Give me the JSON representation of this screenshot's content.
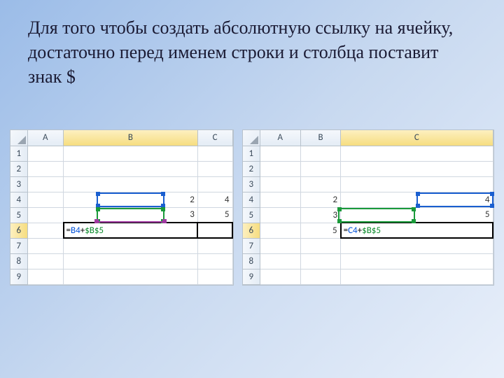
{
  "text": {
    "paragraph": "Для того чтобы создать абсолютную ссылку на ячейку, достаточно перед именем строки и столбца поставит знак $"
  },
  "sheet_left": {
    "columns": [
      "A",
      "B",
      "C"
    ],
    "rows": [
      "1",
      "2",
      "3",
      "4",
      "5",
      "6",
      "7",
      "8",
      "9"
    ],
    "active_column": "B",
    "active_row": "6",
    "cells": {
      "B4": "2",
      "C4": "4",
      "B5": "3",
      "C5": "5"
    },
    "formula_cell": "B6",
    "formula_parts": {
      "eq": "=",
      "ref1": "B4",
      "plus": "+",
      "ref2": "$B$5"
    },
    "ranges": {
      "blue": "B4",
      "green": "B5",
      "purple_underline": "B5"
    }
  },
  "sheet_right": {
    "columns": [
      "A",
      "B",
      "C"
    ],
    "rows": [
      "1",
      "2",
      "3",
      "4",
      "5",
      "6",
      "7",
      "8",
      "9"
    ],
    "active_column": "C",
    "active_row": "6",
    "cells": {
      "B4": "2",
      "C4": "4",
      "B5": "3",
      "C5": "5",
      "B6": "5"
    },
    "formula_cell": "C6",
    "formula_parts": {
      "eq": "=",
      "ref1": "C4",
      "plus": "+",
      "ref2": "$B$5"
    },
    "ranges": {
      "blue": "C4",
      "green": "B5"
    }
  }
}
